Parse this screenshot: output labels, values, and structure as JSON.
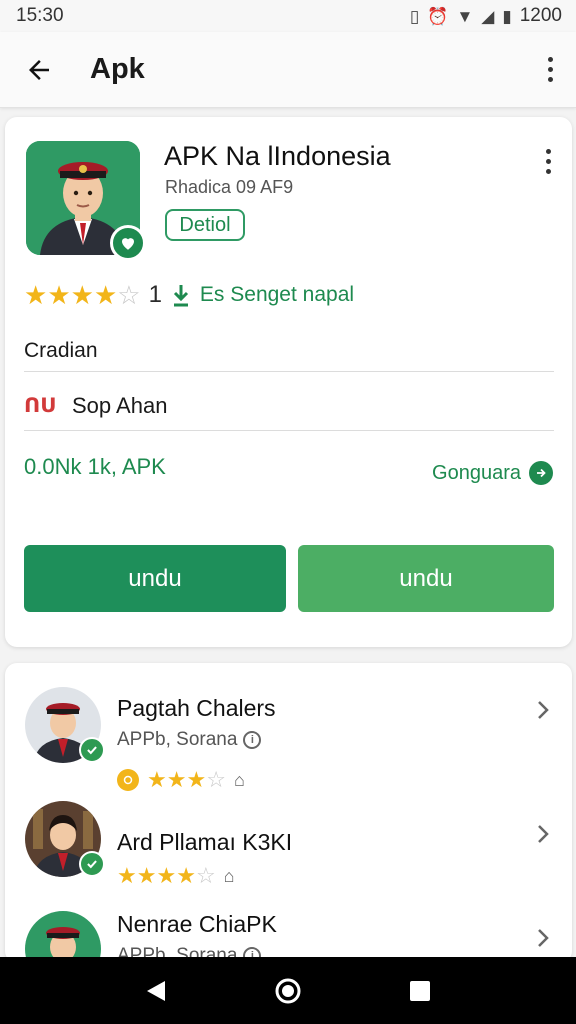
{
  "status_bar": {
    "time": "15:30",
    "battery_text": "1200"
  },
  "app_bar": {
    "title": "Apk"
  },
  "app": {
    "name": "APK Na lIndonesia",
    "subtitle": "Rhadica 09 AF9",
    "tag_label": "Detiol",
    "rating_filled": 3,
    "rating_half": 1,
    "rating_total": 5,
    "rating_count": "1",
    "rating_tag": "Es Senget napal",
    "category": "Cradian",
    "developer": "Sop Ahan",
    "size_text": "0.0Nk 1k, APK",
    "link_label": "Gonguara"
  },
  "buttons": {
    "primary_label": "undu",
    "secondary_label": "undu"
  },
  "list": [
    {
      "title": "Pagtah Chalers",
      "subtitle": "APPb, Sorana",
      "stars": 3
    },
    {
      "title": "Ard Pllamaı K3KI",
      "subtitle": "",
      "stars": 4
    },
    {
      "title": "Nenrae ChiaPK",
      "subtitle": "APPb, Sorana",
      "stars": 0
    }
  ],
  "colors": {
    "accent": "#1e8f5a",
    "accent_light": "#4cae64",
    "star": "#f2b51a"
  }
}
